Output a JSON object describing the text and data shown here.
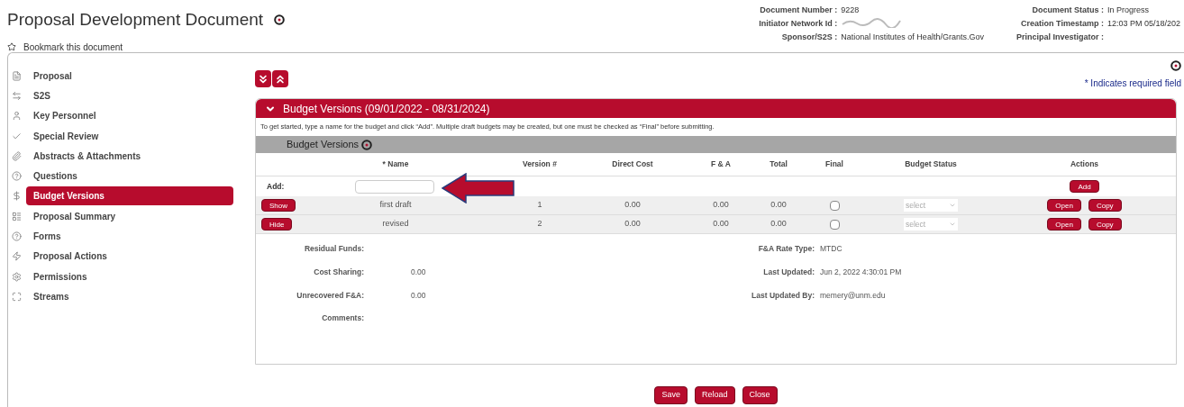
{
  "header": {
    "title": "Proposal Development Document",
    "bookmark": "Bookmark this document",
    "info": [
      {
        "label": "Document Number :",
        "value": "9228"
      },
      {
        "label": "Document Status :",
        "value": "In Progress"
      },
      {
        "label": "Initiator Network Id :"
      },
      {
        "label": "Creation Timestamp :",
        "value": "12:03 PM 05/18/202"
      },
      {
        "label": "Sponsor/S2S :",
        "value": "National Institutes of Health/Grants.Gov"
      },
      {
        "label": "Principal Investigator :"
      }
    ]
  },
  "sidebar": {
    "items": [
      {
        "label": "Proposal",
        "selected": false
      },
      {
        "label": "S2S",
        "selected": false
      },
      {
        "label": "Key Personnel",
        "selected": false
      },
      {
        "label": "Special Review",
        "selected": false
      },
      {
        "label": "Abstracts & Attachments",
        "selected": false
      },
      {
        "label": "Questions",
        "selected": false
      },
      {
        "label": "Budget Versions",
        "selected": true
      },
      {
        "label": "Proposal Summary",
        "selected": false
      },
      {
        "label": "Forms",
        "selected": false
      },
      {
        "label": "Proposal Actions",
        "selected": false
      },
      {
        "label": "Permissions",
        "selected": false
      },
      {
        "label": "Streams",
        "selected": false
      }
    ]
  },
  "required_note": "* Indicates required field",
  "section": {
    "title": "Budget Versions (09/01/2022 - 08/31/2024)",
    "instructions": "To get started, type a name for the budget and click “Add”. Multiple draft budgets may be created, but one must be checked as “Final” before submitting.",
    "subheader": "Budget Versions",
    "columns": [
      "* Name",
      "Version #",
      "Direct Cost",
      "F & A",
      "Total",
      "Final",
      "Budget Status",
      "Actions"
    ],
    "add_label": "Add:",
    "add_button": "Add",
    "rows": [
      {
        "toggle": "Show",
        "name": "first draft",
        "version": "1",
        "direct_cost": "0.00",
        "fa": "0.00",
        "total": "0.00",
        "final": false,
        "status": "select",
        "actions": [
          "Open",
          "Copy"
        ]
      },
      {
        "toggle": "Hide",
        "name": "revised",
        "version": "2",
        "direct_cost": "0.00",
        "fa": "0.00",
        "total": "0.00",
        "final": false,
        "status": "select",
        "actions": [
          "Open",
          "Copy"
        ]
      }
    ],
    "details_left": [
      {
        "label": "Residual Funds:"
      },
      {
        "label": "Cost Sharing:",
        "value": "0.00"
      },
      {
        "label": "Unrecovered F&A:",
        "value": "0.00"
      },
      {
        "label": "Comments:"
      }
    ],
    "details_right": [
      {
        "label": "F&A Rate Type:",
        "value": "MTDC"
      },
      {
        "label": "Last Updated:",
        "value": "Jun 2, 2022 4:30:01 PM"
      },
      {
        "label": "Last Updated By:",
        "value": "memery@unm.edu"
      }
    ]
  },
  "buttons": [
    "Save",
    "Reload",
    "Close"
  ]
}
